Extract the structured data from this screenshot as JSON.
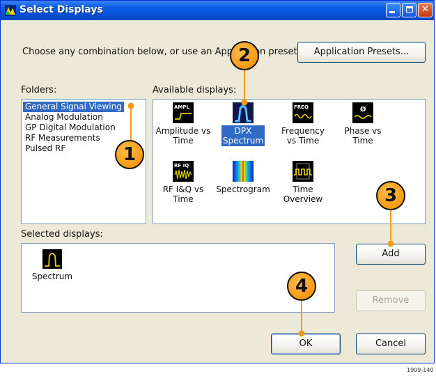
{
  "window": {
    "title": "Select Displays"
  },
  "prompt": "Choose any combination below, or use an Application preset.",
  "buttons": {
    "presets": "Application Presets...",
    "add": "Add",
    "remove": "Remove",
    "ok": "OK",
    "cancel": "Cancel"
  },
  "labels": {
    "folders": "Folders:",
    "available": "Available displays:",
    "selected": "Selected displays:"
  },
  "folders": [
    "General Signal Viewing",
    "Analog Modulation",
    "GP Digital Modulation",
    "RF Measurements",
    "Pulsed RF"
  ],
  "selected_folder": "General Signal Viewing",
  "available_displays": [
    {
      "icon_text": "AMPL",
      "line1": "Amplitude vs",
      "line2": "Time"
    },
    {
      "icon_text": "",
      "line1": "DPX",
      "line2": "Spectrum"
    },
    {
      "icon_text": "FREQ",
      "line1": "Frequency",
      "line2": "vs Time"
    },
    {
      "icon_text": "Ø",
      "line1": "Phase vs",
      "line2": "Time"
    },
    {
      "icon_text": "RF IQ",
      "line1": "RF I&Q vs",
      "line2": "Time"
    },
    {
      "icon_text": "",
      "line1": "Spectrogram",
      "line2": ""
    },
    {
      "icon_text": "",
      "line1": "Time",
      "line2": "Overview"
    }
  ],
  "selected_displays": [
    {
      "label": "Spectrum"
    }
  ],
  "callouts": [
    "1",
    "2",
    "3",
    "4"
  ],
  "figure_number": "1909-140"
}
